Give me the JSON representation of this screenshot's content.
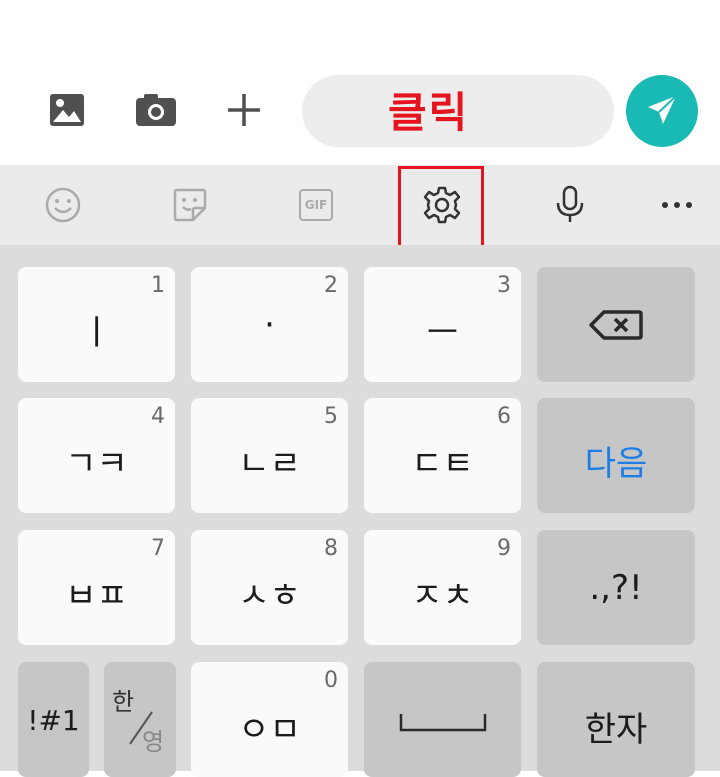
{
  "message_bar": {
    "icons": [
      "image-icon",
      "camera-icon",
      "plus-icon"
    ],
    "input_placeholder": "",
    "send_icon": "send-icon"
  },
  "annotation": {
    "label": "클릭",
    "color": "#e5141f"
  },
  "toolbar": {
    "icons": [
      "emoji-icon",
      "sticker-icon",
      "gif-icon",
      "settings-icon",
      "microphone-icon",
      "more-icon"
    ],
    "gif_label": "GIF",
    "more_label": "···"
  },
  "keyboard": {
    "row1": [
      {
        "label": "ㅣ",
        "number": "1"
      },
      {
        "label": "·",
        "number": "2"
      },
      {
        "label": "ㅡ",
        "number": "3"
      },
      {
        "label": "",
        "icon": "backspace-icon"
      }
    ],
    "row2": [
      {
        "label": "ㄱㅋ",
        "number": "4"
      },
      {
        "label": "ㄴㄹ",
        "number": "5"
      },
      {
        "label": "ㄷㅌ",
        "number": "6"
      },
      {
        "label": "다음"
      }
    ],
    "row3": [
      {
        "label": "ㅂㅍ",
        "number": "7"
      },
      {
        "label": "ㅅㅎ",
        "number": "8"
      },
      {
        "label": "ㅈㅊ",
        "number": "9"
      },
      {
        "label": ".,?!"
      }
    ],
    "row4": [
      {
        "label": "!#1"
      },
      {
        "label_top": "한",
        "label_bottom": "영"
      },
      {
        "label": "ㅇㅁ",
        "number": "0"
      },
      {
        "label": "",
        "icon": "space-icon"
      },
      {
        "label": "한자"
      }
    ]
  },
  "colors": {
    "accent": "#19b9b4",
    "next_key_text": "#1d7ee6",
    "annotation": "#e5141f"
  }
}
